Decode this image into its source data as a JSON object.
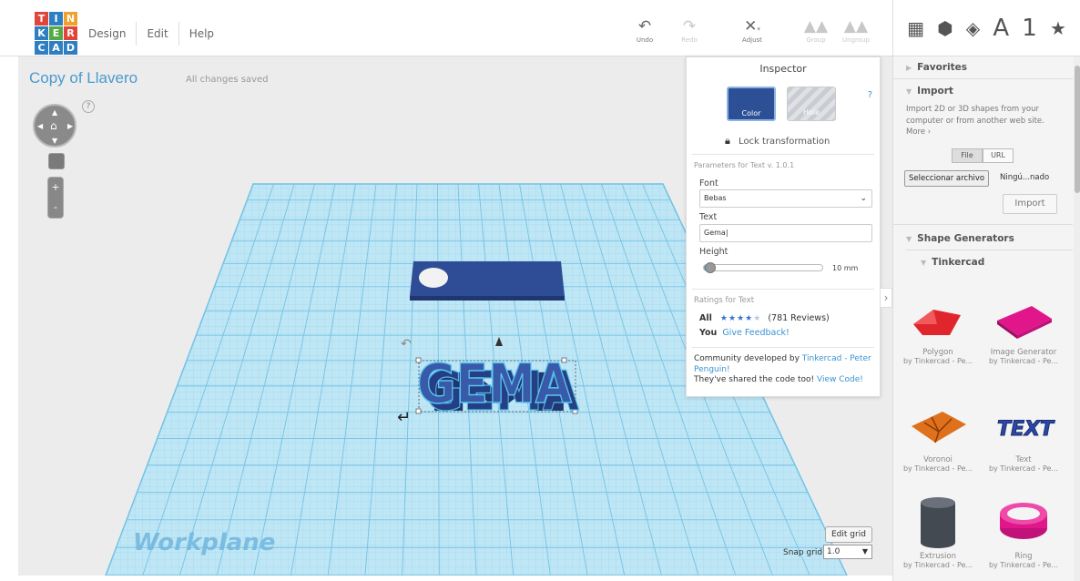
{
  "app": {
    "logo_letters": [
      "T",
      "I",
      "N",
      "K",
      "E",
      "R",
      "C",
      "A",
      "D"
    ],
    "logo_colors": [
      "#e0453c",
      "#2e7fc2",
      "#f0a12b",
      "#2e7fc2",
      "#54a845",
      "#e0453c",
      "#2e7fc2",
      "#2e7fc2",
      "#2e7fc2"
    ],
    "menu": [
      "Design",
      "Edit",
      "Help"
    ],
    "doc_title": "Copy of Llavero",
    "save_status": "All changes saved"
  },
  "toolbar": {
    "undo": "Undo",
    "redo": "Redo",
    "adjust": "Adjust",
    "group": "Group",
    "ungroup": "Ungroup"
  },
  "view_tabs": [
    "grid-icon",
    "box-icon",
    "gem-icon",
    "A",
    "1",
    "star-icon"
  ],
  "canvas": {
    "workplane_label": "Workplane",
    "edit_grid": "Edit grid",
    "snap_grid_label": "Snap grid",
    "snap_grid_value": "1.0",
    "nav_help": "?",
    "model_text": "GEMA"
  },
  "inspector": {
    "title": "Inspector",
    "help": "?",
    "color_label": "Color",
    "hole_label": "Hole",
    "lock_label": "Lock transformation",
    "params_title": "Parameters for Text v. 1.0.1",
    "font_label": "Font",
    "font_value": "Bebas",
    "text_label": "Text",
    "text_value": "Gema",
    "height_label": "Height",
    "height_value": "10 mm",
    "height_level": 0.07,
    "ratings_title": "Ratings for Text",
    "all_label": "All",
    "all_stars": 4,
    "reviews": "(781 Reviews)",
    "you_label": "You",
    "feedback_link": "Give Feedback!",
    "community_prefix": "Community developed by ",
    "community_link": "Tinkercad - Peter Penguin!",
    "shared_text": "They've shared the code too! ",
    "view_code": "View Code!",
    "accent": "#2d4f96"
  },
  "panel": {
    "favorites": "Favorites",
    "import": "Import",
    "import_desc": "Import 2D or 3D shapes from your computer or from another web site.",
    "import_more": "More ›",
    "file_tab": "File",
    "url_tab": "URL",
    "choose_file": "Seleccionar archivo",
    "no_file": "Ningú...nado",
    "import_button": "Import",
    "shape_generators": "Shape Generators",
    "tinkercad": "Tinkercad",
    "generators": [
      {
        "name": "Polygon",
        "by": "by Tinkercad - Pe...",
        "color": "#e0262c"
      },
      {
        "name": "Image Generator",
        "by": "by Tinkercad - Pe...",
        "color": "#e0168a"
      },
      {
        "name": "Voronoi",
        "by": "by Tinkercad - Pe...",
        "color": "#e0711c"
      },
      {
        "name": "Text",
        "by": "by Tinkercad - Pe...",
        "color": "#2c47a8"
      },
      {
        "name": "Extrusion",
        "by": "by Tinkercad - Pe...",
        "color": "#444a52"
      },
      {
        "name": "Ring",
        "by": "by Tinkercad - Pe...",
        "color": "#e0168a"
      }
    ]
  }
}
